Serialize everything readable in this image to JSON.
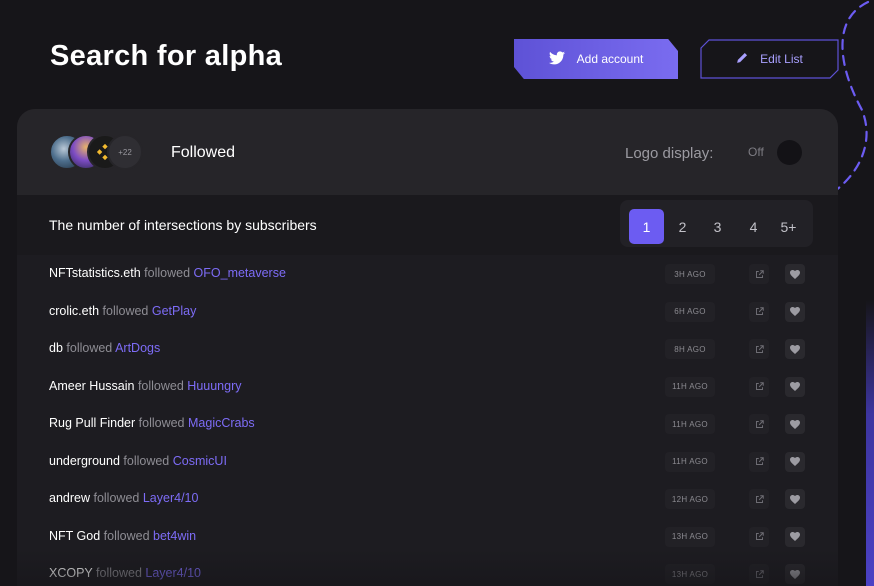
{
  "page": {
    "title": "Search for alpha"
  },
  "toolbar": {
    "add_account_label": "Add account",
    "edit_list_label": "Edit List",
    "twitter_icon": "twitter-icon",
    "pencil_icon": "pencil-icon"
  },
  "followed_header": {
    "extra_count": "+22",
    "label": "Followed",
    "logo_display_label": "Logo display:",
    "toggle_state": "Off"
  },
  "intersections": {
    "label": "The number of intersections by subscribers",
    "pages": [
      "1",
      "2",
      "3",
      "4",
      "5+"
    ],
    "active_page": "1"
  },
  "feed": [
    {
      "user": "NFTstatistics.eth",
      "verb": "followed",
      "target": "OFO_metaverse",
      "ago": "3H AGO"
    },
    {
      "user": "crolic.eth",
      "verb": "followed",
      "target": "GetPlay",
      "ago": "6H AGO"
    },
    {
      "user": "db",
      "verb": "followed",
      "target": "ArtDogs",
      "ago": "8H AGO"
    },
    {
      "user": "Ameer Hussain",
      "verb": "followed",
      "target": "Huuungry",
      "ago": "11H AGO"
    },
    {
      "user": "Rug Pull Finder",
      "verb": "followed",
      "target": "MagicCrabs",
      "ago": "11H AGO"
    },
    {
      "user": "underground",
      "verb": "followed",
      "target": "CosmicUI",
      "ago": "11H AGO"
    },
    {
      "user": "andrew",
      "verb": "followed",
      "target": "Layer4/10",
      "ago": "12H AGO"
    },
    {
      "user": "NFT God",
      "verb": "followed",
      "target": "bet4win",
      "ago": "13H AGO"
    },
    {
      "user": "XCOPY",
      "verb": "followed",
      "target": "Layer4/10",
      "ago": "13H AGO"
    }
  ],
  "colors": {
    "accent": "#6c5cf2",
    "link": "#7d6cf6",
    "background": "#161519",
    "panel": "#1d1c21"
  }
}
